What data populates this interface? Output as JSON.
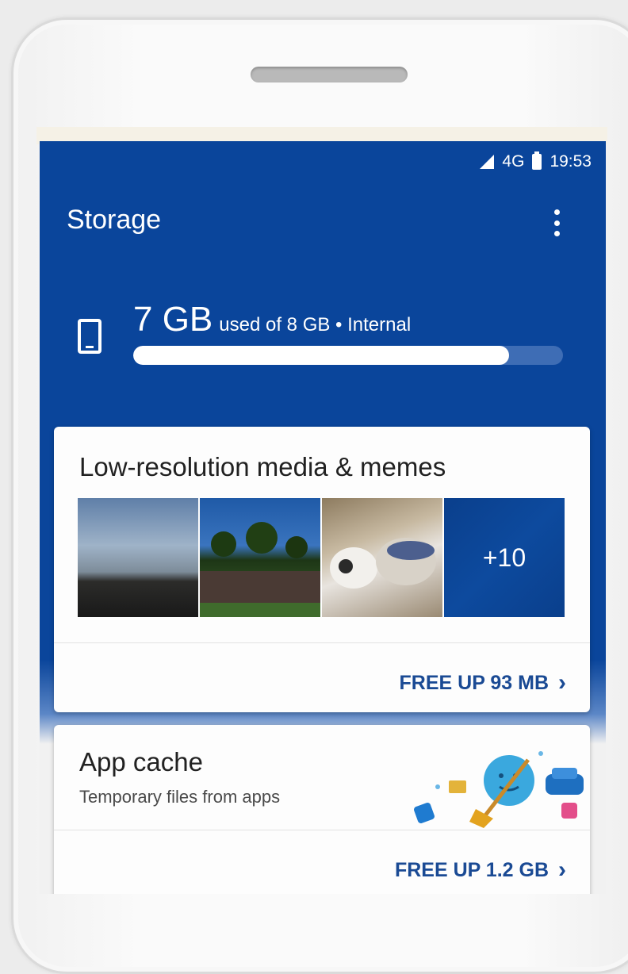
{
  "status_bar": {
    "network": "4G",
    "time": "19:53"
  },
  "app_bar": {
    "title": "Storage",
    "menu_icon": "more-vert-icon"
  },
  "storage": {
    "device_icon": "smartphone-icon",
    "used": "7 GB",
    "detail": "used of 8 GB • Internal",
    "used_fraction": 0.875
  },
  "cards": {
    "low_res": {
      "title": "Low-resolution media & memes",
      "more_count": "+10",
      "action": "FREE UP 93 MB"
    },
    "app_cache": {
      "title": "App cache",
      "subtitle": "Temporary files from apps",
      "action": "FREE UP 1.2 GB"
    }
  },
  "colors": {
    "primary": "#0a459b",
    "action_text": "#1a4a94"
  }
}
